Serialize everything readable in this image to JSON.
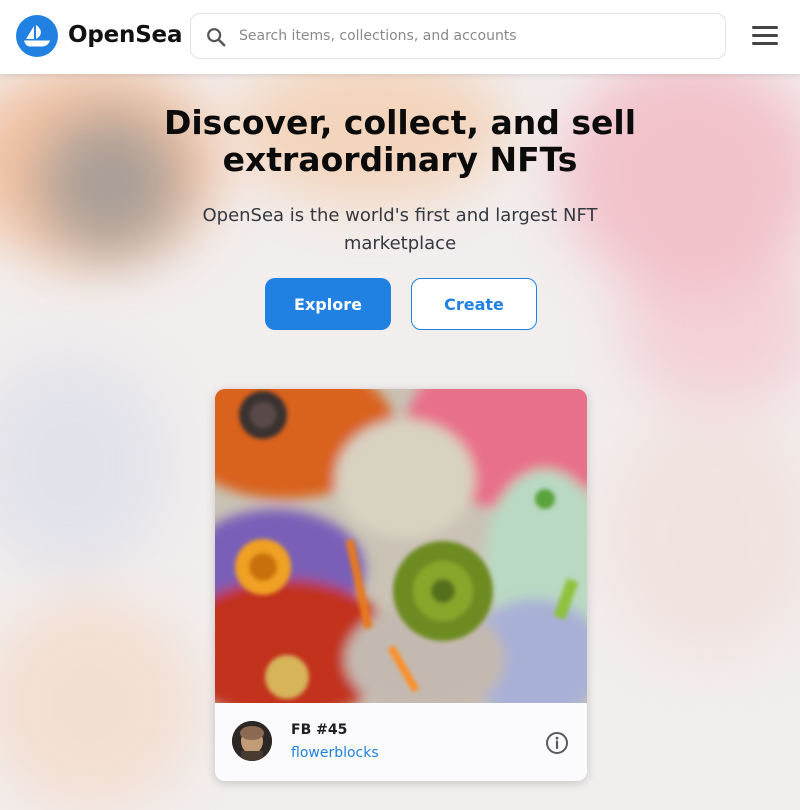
{
  "header": {
    "brand": "OpenSea",
    "search": {
      "placeholder": "Search items, collections, and accounts",
      "value": ""
    },
    "menu_icon": "hamburger-menu-icon"
  },
  "hero": {
    "headline_line1": "Discover, collect, and sell",
    "headline_line2": "extraordinary NFTs",
    "subtitle_line1": "OpenSea is the world's first and largest NFT",
    "subtitle_line2": "marketplace",
    "explore_label": "Explore",
    "create_label": "Create"
  },
  "featured": {
    "name": "FB #45",
    "collection": "flowerblocks",
    "info_icon": "info-icon"
  },
  "colors": {
    "accent": "#2081e2",
    "text": "#0b0b0b",
    "subtext": "#353840"
  }
}
